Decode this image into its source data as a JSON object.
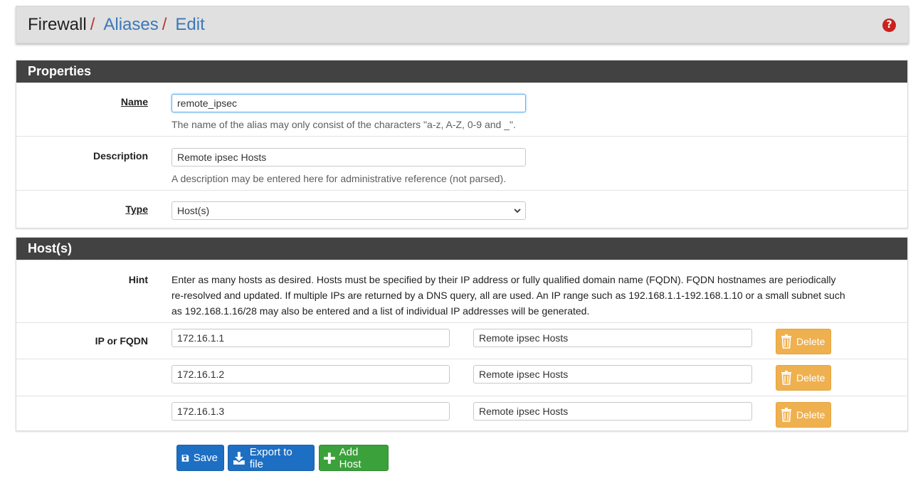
{
  "breadcrumb": {
    "root": "Firewall",
    "sep1": "/",
    "link1": "Aliases",
    "sep2": "/",
    "link2": "Edit"
  },
  "properties": {
    "heading": "Properties",
    "name": {
      "label": "Name",
      "value": "remote_ipsec",
      "help": "The name of the alias may only consist of the characters \"a-z, A-Z, 0-9 and _\"."
    },
    "description": {
      "label": "Description",
      "value": "Remote ipsec Hosts",
      "help": "A description may be entered here for administrative reference (not parsed)."
    },
    "type": {
      "label": "Type",
      "value": "Host(s)"
    }
  },
  "hosts": {
    "heading": "Host(s)",
    "hint_label": "Hint",
    "hint_lines": [
      "Enter as many hosts as desired. Hosts must be specified by their IP address or fully qualified domain name (FQDN). FQDN hostnames are periodically",
      "re-resolved and updated. If multiple IPs are returned by a DNS query, all are used. An IP range such as 192.168.1.1-192.168.1.10 or a small subnet such",
      "as 192.168.1.16/28 may also be entered and a list of individual IP addresses will be generated."
    ],
    "ip_label": "IP or FQDN",
    "delete_label": "Delete",
    "entries": [
      {
        "ip": "172.16.1.1",
        "desc": "Remote ipsec Hosts"
      },
      {
        "ip": "172.16.1.2",
        "desc": "Remote ipsec Hosts"
      },
      {
        "ip": "172.16.1.3",
        "desc": "Remote ipsec Hosts"
      }
    ]
  },
  "actions": {
    "save": "Save",
    "export": "Export to file",
    "add_host": "Add Host"
  },
  "icons": {
    "help": "question-circle-icon",
    "delete": "trash-icon",
    "save": "save-icon",
    "export": "download-icon",
    "add": "plus-icon"
  },
  "colors": {
    "heading_bg": "#424242",
    "link": "#3c78b9",
    "delete_btn": "#efb04f",
    "primary_btn": "#1d6fc4",
    "success_btn": "#3ba13b"
  }
}
